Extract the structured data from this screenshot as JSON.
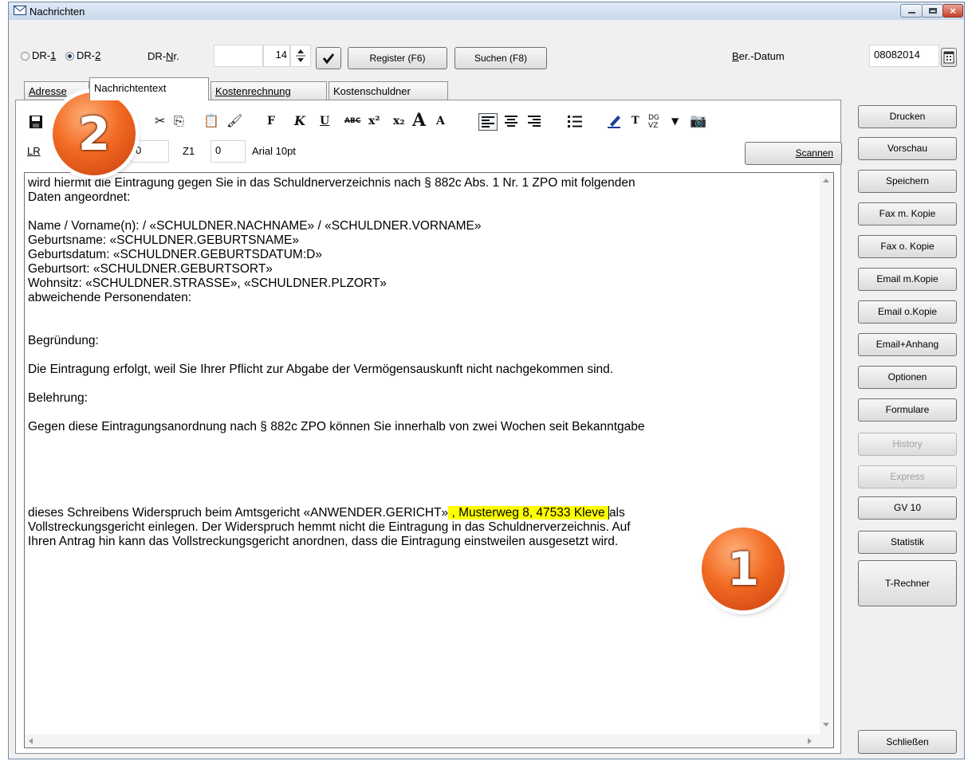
{
  "window": {
    "title": "Nachrichten",
    "close_label": "×"
  },
  "top": {
    "radio1": "DR-1",
    "radio2": "DR-2",
    "drnr_label": "DR-Nr.",
    "drnr_value": "",
    "spin_value": "14",
    "register_btn": "Register (F6)",
    "suchen_btn": "Suchen (F8)",
    "ber_datum_label": "Ber.-Datum",
    "date_value": "08082014"
  },
  "tabs": [
    "Adresse",
    "Nachrichtentext",
    "Kostenrechnung",
    "Kostenschuldner"
  ],
  "toolbar": {
    "icons": [
      "save-icon",
      "cut-icon",
      "copy-icon",
      "paste-icon",
      "format-brush-icon",
      "bold-icon",
      "italic-icon",
      "underline-icon",
      "strikethrough-icon",
      "superscript-icon",
      "subscript-icon",
      "grow-font-icon",
      "shrink-font-icon",
      "align-left-icon",
      "align-center-icon",
      "align-right-icon",
      "bullet-list-icon",
      "highlight-pen-icon",
      "text-icon",
      "dgvz-icon",
      "dropdown-icon",
      "camera-icon"
    ],
    "lr_label": "LR",
    "lr_value": "0",
    "z1_label": "Z1",
    "z1_value": "0",
    "font_info": "Arial 10pt",
    "scannen_btn": "Scannen"
  },
  "editor": {
    "lines": [
      "wird hiermit die Eintragung gegen Sie in das Schuldnerverzeichnis nach § 882c Abs. 1 Nr. 1 ZPO mit folgenden",
      "Daten angeordnet:",
      "",
      "Name / Vorname(n):  / «SCHULDNER.NACHNAME» / «SCHULDNER.VORNAME»",
      "Geburtsname: «SCHULDNER.GEBURTSNAME»",
      "Geburtsdatum: «SCHULDNER.GEBURTSDATUM:D»",
      "Geburtsort: «SCHULDNER.GEBURTSORT»",
      "Wohnsitz: «SCHULDNER.STRASSE», «SCHULDNER.PLZORT»",
      "abweichende Personendaten:",
      "",
      "",
      "Begründung:",
      "",
      "Die Eintragung erfolgt, weil Sie Ihrer Pflicht zur Abgabe der Vermögensauskunft nicht nachgekommen sind.",
      "",
      "Belehrung:",
      "",
      "Gegen diese Eintragungsanordnung nach § 882c ZPO können Sie innerhalb von zwei Wochen seit Bekanntgabe"
    ],
    "line_hl_before": "dieses Schreibens Widerspruch beim Amtsgericht «ANWENDER.GERICHT»",
    "line_hl_text": " , Musterweg 8, 47533 Kleve ",
    "line_hl_after": "als",
    "line_after1": "Vollstreckungsgericht einlegen. Der Widerspruch hemmt nicht die Eintragung in das Schuldnerverzeichnis. Auf",
    "line_after2": "Ihren Antrag hin kann das Vollstreckungsgericht anordnen, dass die Eintragung einstweilen ausgesetzt wird."
  },
  "side_buttons": [
    "Drucken",
    "Vorschau",
    "Speichern",
    "Fax m. Kopie",
    "Fax o. Kopie",
    "Email m.Kopie",
    "Email o.Kopie",
    "Email+Anhang",
    "Optionen",
    "Formulare",
    "History",
    "Express",
    "GV 10",
    "Statistik",
    "T-Rechner",
    "Schließen"
  ],
  "badges": [
    "1",
    "2"
  ],
  "colors": {
    "highlight": "#ffff00",
    "badge": "#f26a22"
  }
}
